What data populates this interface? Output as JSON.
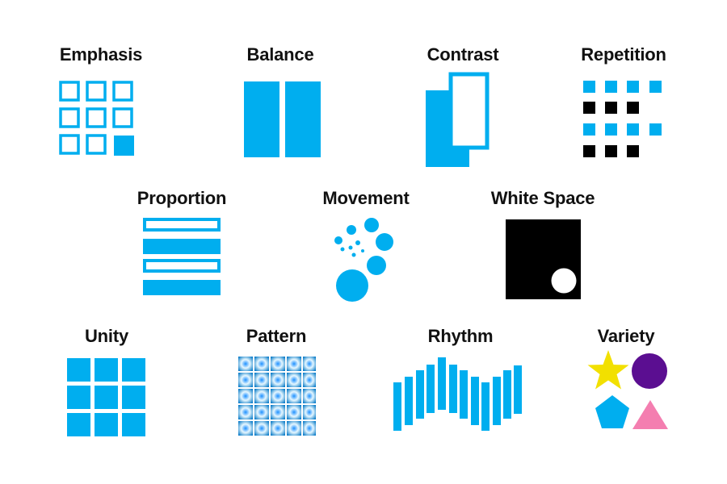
{
  "colors": {
    "blue": "#00AEEF",
    "black": "#000000",
    "white": "#FFFFFF",
    "yellow": "#F2E000",
    "purple": "#5B0E91",
    "pink": "#F47EB0",
    "text": "#111111"
  },
  "principles": {
    "emphasis": "Emphasis",
    "balance": "Balance",
    "contrast": "Contrast",
    "repetition": "Repetition",
    "proportion": "Proportion",
    "movement": "Movement",
    "white_space": "White Space",
    "unity": "Unity",
    "pattern": "Pattern",
    "rhythm": "Rhythm",
    "variety": "Variety"
  }
}
